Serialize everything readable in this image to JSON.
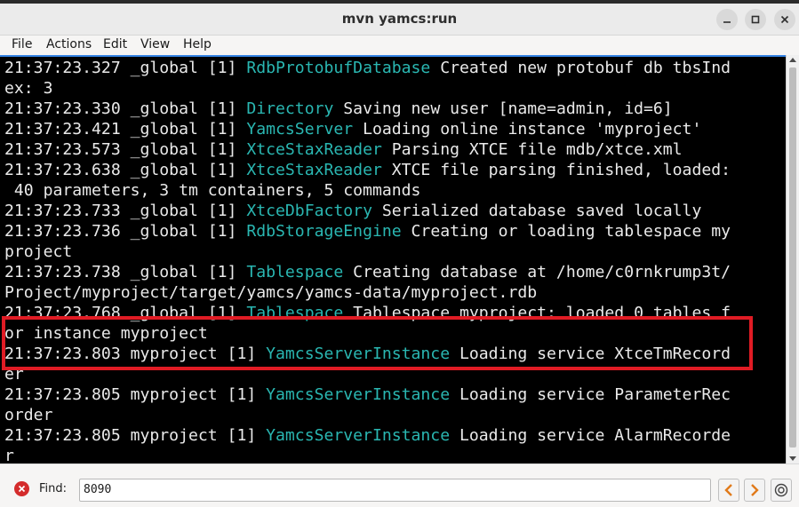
{
  "window": {
    "title": "mvn yamcs:run"
  },
  "menu": [
    {
      "label": "File"
    },
    {
      "label": "Actions"
    },
    {
      "label": "Edit"
    },
    {
      "label": "View"
    },
    {
      "label": "Help"
    }
  ],
  "terminal": {
    "lines": [
      {
        "pre": "21:37:23.327 _global [1] ",
        "cls": "RdbProtobufDatabase",
        "post": " Created new protobuf db tbsInd"
      },
      {
        "pre": "ex: 3",
        "cls": "",
        "post": ""
      },
      {
        "pre": "21:37:23.330 _global [1] ",
        "cls": "Directory",
        "post": " Saving new user [name=admin, id=6]"
      },
      {
        "pre": "21:37:23.421 _global [1] ",
        "cls": "YamcsServer",
        "post": " Loading online instance 'myproject'"
      },
      {
        "pre": "21:37:23.573 _global [1] ",
        "cls": "XtceStaxReader",
        "post": " Parsing XTCE file mdb/xtce.xml"
      },
      {
        "pre": "21:37:23.638 _global [1] ",
        "cls": "XtceStaxReader",
        "post": " XTCE file parsing finished, loaded:"
      },
      {
        "pre": " 40 parameters, 3 tm containers, 5 commands",
        "cls": "",
        "post": ""
      },
      {
        "pre": "21:37:23.733 _global [1] ",
        "cls": "XtceDbFactory",
        "post": " Serialized database saved locally"
      },
      {
        "pre": "21:37:23.736 _global [1] ",
        "cls": "RdbStorageEngine",
        "post": " Creating or loading tablespace my"
      },
      {
        "pre": "project",
        "cls": "",
        "post": ""
      },
      {
        "pre": "21:37:23.738 _global [1] ",
        "cls": "Tablespace",
        "post": " Creating database at /home/c0rnkrump3t/"
      },
      {
        "pre": "Project/myproject/target/yamcs/yamcs-data/myproject.rdb",
        "cls": "",
        "post": ""
      },
      {
        "pre": "21:37:23.768 _global [1] ",
        "cls": "Tablespace",
        "post": " Tablespace myproject: loaded 0 tables f"
      },
      {
        "pre": "or instance myproject",
        "cls": "",
        "post": ""
      },
      {
        "pre": "21:37:23.803 myproject [1] ",
        "cls": "YamcsServerInstance",
        "post": " Loading service XtceTmRecord"
      },
      {
        "pre": "er",
        "cls": "",
        "post": ""
      },
      {
        "pre": "21:37:23.805 myproject [1] ",
        "cls": "YamcsServerInstance",
        "post": " Loading service ParameterRec"
      },
      {
        "pre": "order",
        "cls": "",
        "post": ""
      },
      {
        "pre": "21:37:23.805 myproject [1] ",
        "cls": "YamcsServerInstance",
        "post": " Loading service AlarmRecorde"
      },
      {
        "pre": "r",
        "cls": "",
        "post": ""
      }
    ]
  },
  "find": {
    "label": "Find:",
    "value": "8090"
  },
  "colors": {
    "terminal_bg": "#000000",
    "text": "#eaeaea",
    "class_name": "#2ab7b2",
    "highlight": "#e01b24",
    "accent": "#3584e4"
  },
  "icons": [
    "minimize-icon",
    "maximize-icon",
    "close-icon",
    "clear-find-icon",
    "find-previous-icon",
    "find-next-icon",
    "find-options-icon"
  ]
}
